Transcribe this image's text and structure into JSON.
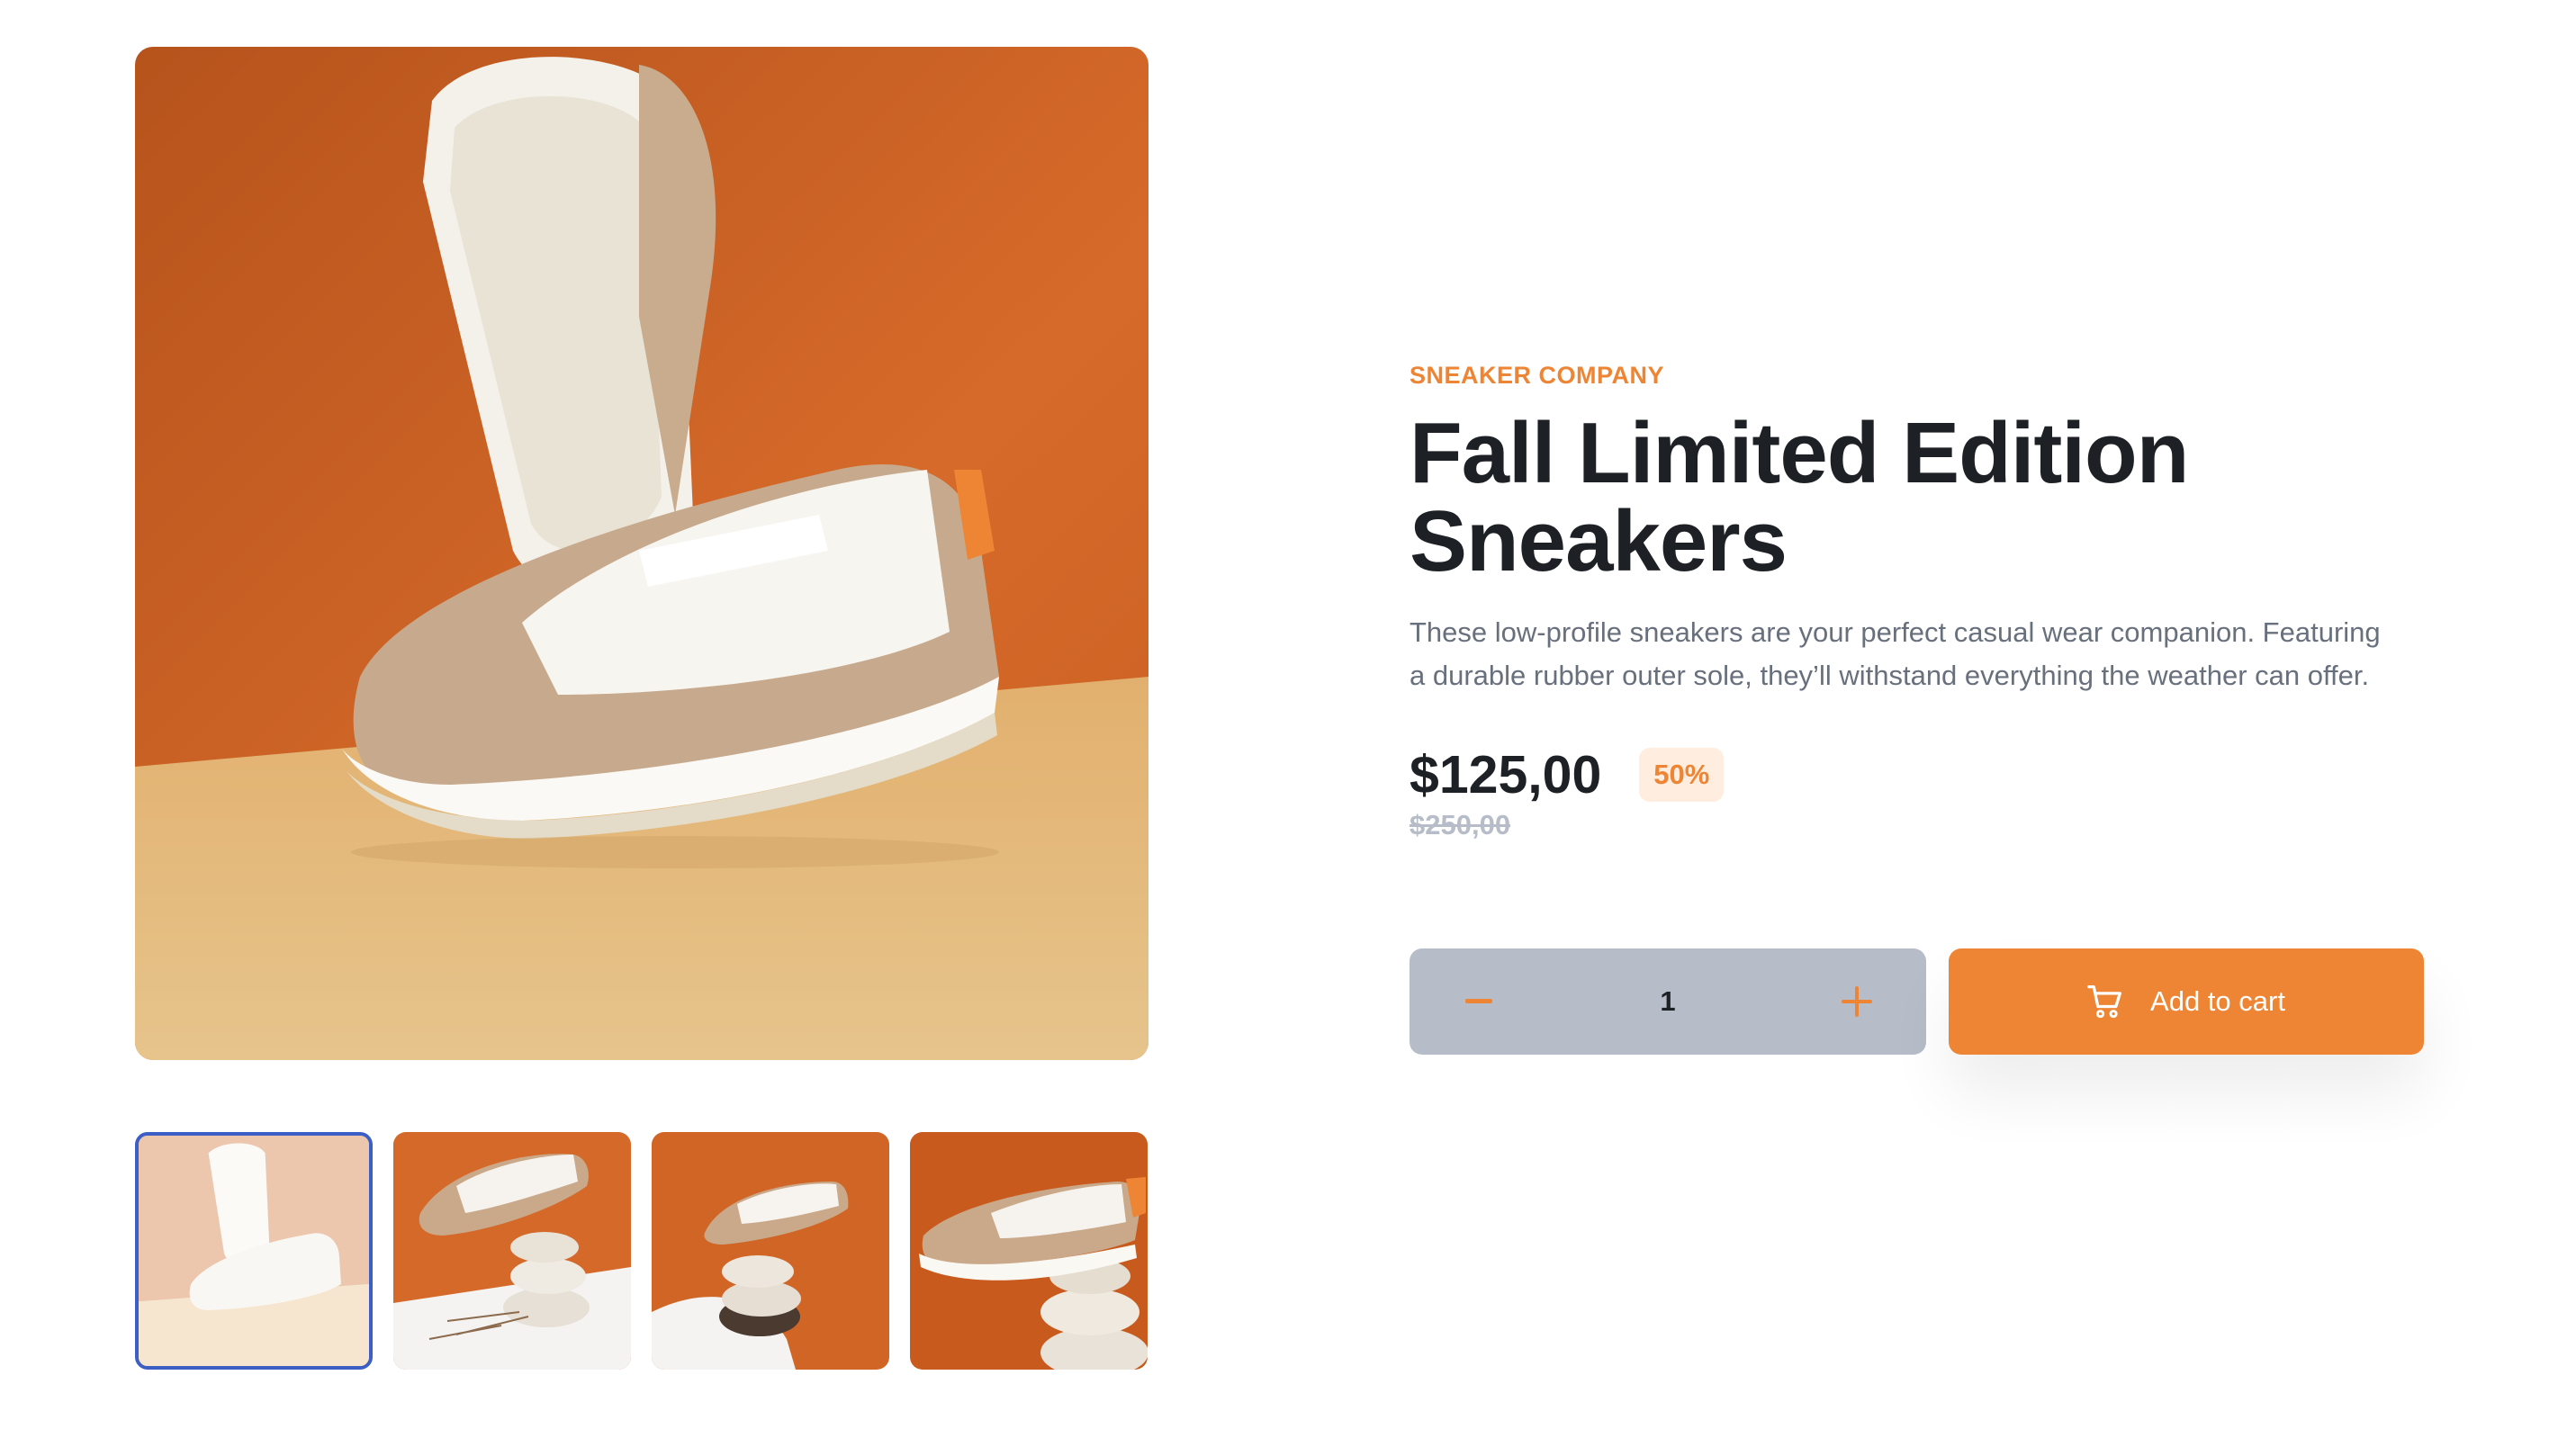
{
  "gallery": {
    "main_image_alt": "",
    "active_thumbnail": 1
  },
  "product": {
    "company": "Sneaker Company",
    "title": "Fall Limited Edition Sneakers",
    "description": "These low-profile sneakers are your perfect casual wear companion. Featuring a durable rubber outer sole, they’ll withstand everything the weather can offer.",
    "price": "$125,00",
    "discount": "50%",
    "original_price": "$250,00"
  },
  "cart": {
    "quantity": "1",
    "add_label": "Add to cart"
  },
  "colors": {
    "accent": "#ee8535",
    "accent_pale": "#ffede0",
    "dark": "#1d2025",
    "grey": "#68707d",
    "light_grey": "#b6bcc8",
    "active_border": "#3b5fc4"
  },
  "icons": {
    "minus": "minus-icon",
    "plus": "plus-icon",
    "cart": "cart-icon"
  }
}
